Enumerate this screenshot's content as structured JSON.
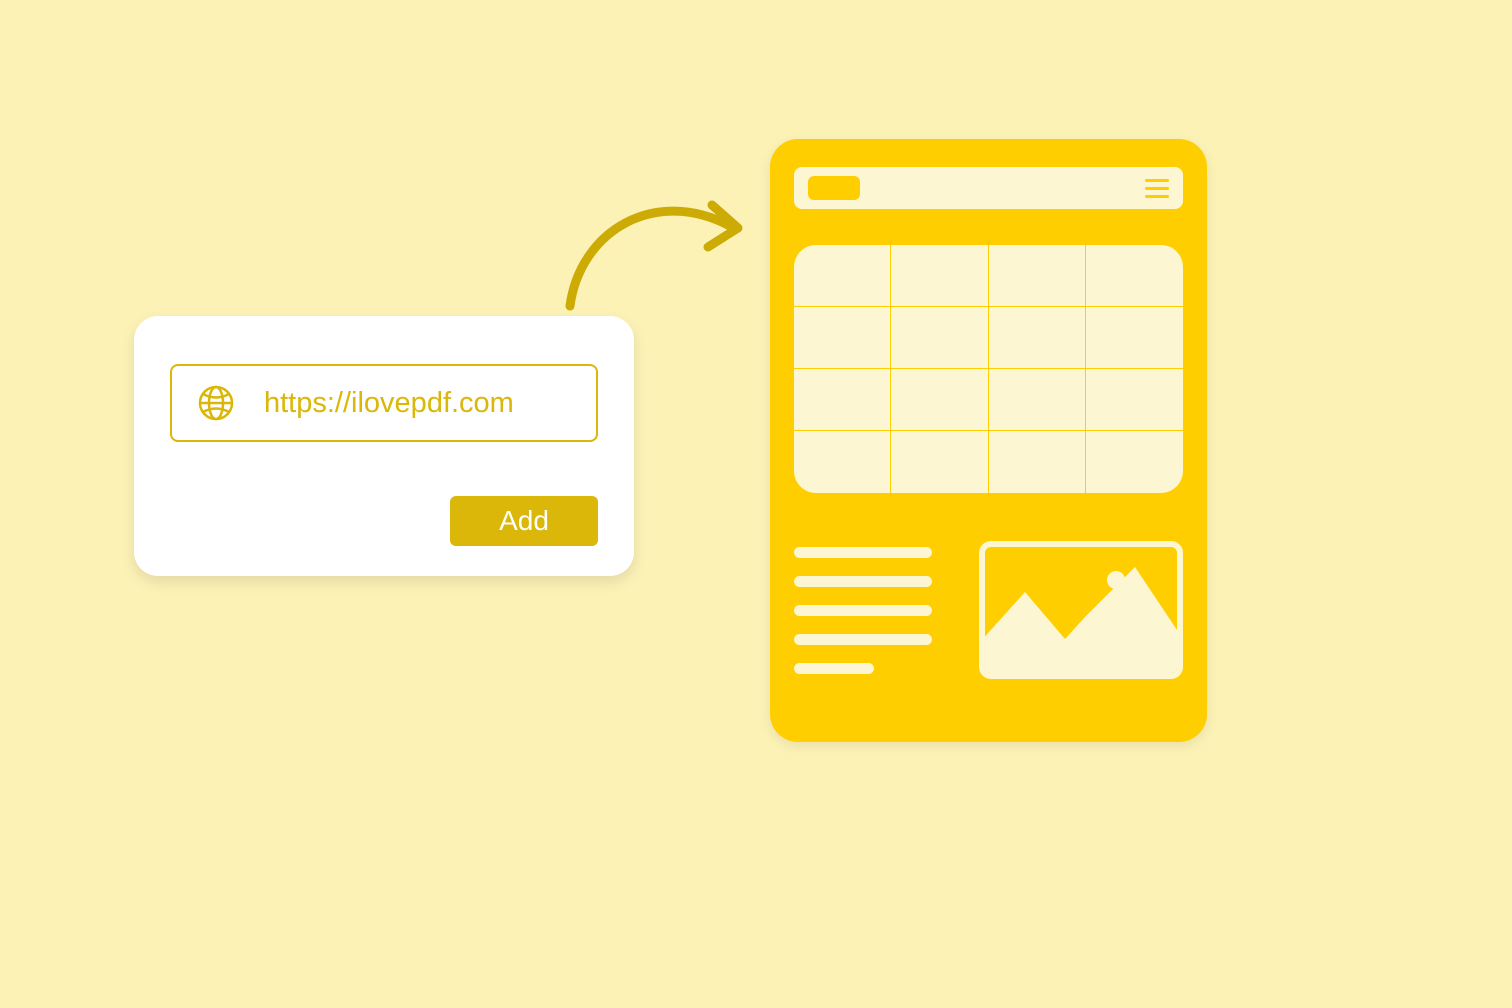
{
  "url_input": {
    "value": "https://ilovepdf.com",
    "add_button_label": "Add"
  },
  "colors": {
    "background": "#fcf2b6",
    "accent": "#dab708",
    "doc_bg": "#ffce00",
    "doc_light": "#fdf6d2"
  }
}
